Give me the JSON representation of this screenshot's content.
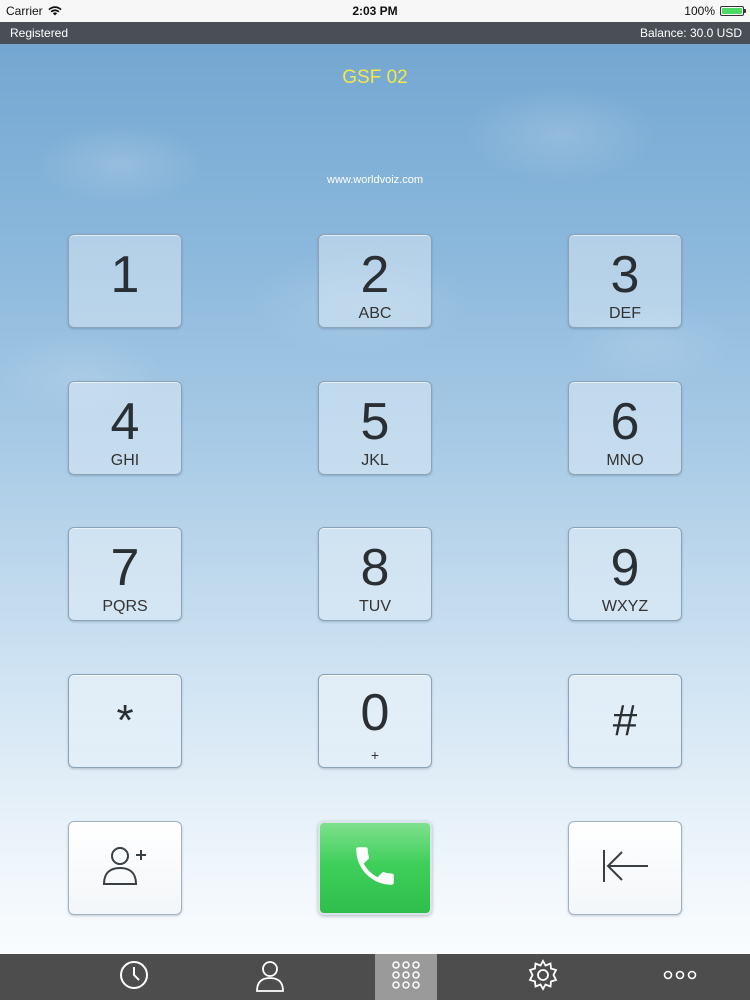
{
  "status_bar": {
    "carrier": "Carrier",
    "time": "2:03 PM",
    "battery": "100%"
  },
  "account_bar": {
    "status": "Registered",
    "balance": "Balance: 30.0 USD"
  },
  "header": {
    "account_name": "GSF 02",
    "website": "www.worldvoiz.com",
    "account_name_color": "#f2e84a"
  },
  "keypad": {
    "keys": [
      {
        "digit": "1",
        "letters": ""
      },
      {
        "digit": "2",
        "letters": "ABC"
      },
      {
        "digit": "3",
        "letters": "DEF"
      },
      {
        "digit": "4",
        "letters": "GHI"
      },
      {
        "digit": "5",
        "letters": "JKL"
      },
      {
        "digit": "6",
        "letters": "MNO"
      },
      {
        "digit": "7",
        "letters": "PQRS"
      },
      {
        "digit": "8",
        "letters": "TUV"
      },
      {
        "digit": "9",
        "letters": "WXYZ"
      },
      {
        "digit": "*",
        "letters": ""
      },
      {
        "digit": "0",
        "letters": "+"
      },
      {
        "digit": "#",
        "letters": ""
      }
    ]
  },
  "actions": {
    "add_contact_icon": "add-contact-icon",
    "call_icon": "phone-icon",
    "backspace_icon": "backspace-icon",
    "call_color": "#3fcf5b"
  },
  "tab_bar": {
    "tabs": [
      {
        "icon": "clock-icon",
        "active": false
      },
      {
        "icon": "person-icon",
        "active": false
      },
      {
        "icon": "keypad-icon",
        "active": true
      },
      {
        "icon": "gear-icon",
        "active": false
      },
      {
        "icon": "more-icon",
        "active": false
      }
    ]
  }
}
